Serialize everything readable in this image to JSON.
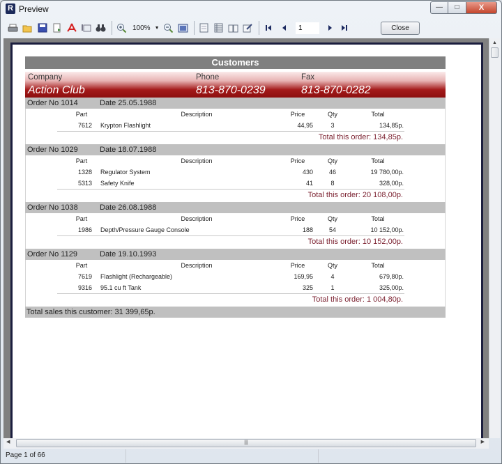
{
  "window": {
    "title": "Preview",
    "app_icon": "R",
    "buttons": {
      "minimize": "—",
      "maximize": "□",
      "close": "X"
    }
  },
  "toolbar": {
    "icons": [
      {
        "name": "print-icon",
        "glyph": "🖨"
      },
      {
        "name": "open-icon",
        "glyph": "📂"
      },
      {
        "name": "save-icon",
        "glyph": "💾"
      },
      {
        "name": "export-icon",
        "glyph": "📄"
      },
      {
        "name": "pdf-icon",
        "glyph": "ᴧ"
      },
      {
        "name": "email-icon",
        "glyph": "✉"
      },
      {
        "name": "find-icon",
        "glyph": "⚲"
      }
    ],
    "zoom_value": "100%",
    "page_number": "1",
    "close_label": "Close"
  },
  "report": {
    "title": "Customers",
    "customer": {
      "company_label": "Company",
      "phone_label": "Phone",
      "fax_label": "Fax",
      "company": "Action Club",
      "phone": "813-870-0239",
      "fax": "813-870-0282"
    },
    "columns": {
      "part": "Part",
      "description": "Description",
      "price": "Price",
      "qty": "Qty",
      "total": "Total"
    },
    "orders": [
      {
        "order_no": "Order No 1014",
        "date": "Date 25.05.1988",
        "items": [
          {
            "part": "7612",
            "description": "Krypton Flashlight",
            "price": "44,95",
            "qty": "3",
            "total": "134,85p."
          }
        ],
        "order_total": "Total this order: 134,85p."
      },
      {
        "order_no": "Order No 1029",
        "date": "Date 18.07.1988",
        "items": [
          {
            "part": "1328",
            "description": "Regulator System",
            "price": "430",
            "qty": "46",
            "total": "19 780,00p."
          },
          {
            "part": "5313",
            "description": "Safety Knife",
            "price": "41",
            "qty": "8",
            "total": "328,00p."
          }
        ],
        "order_total": "Total this order: 20 108,00p."
      },
      {
        "order_no": "Order No 1038",
        "date": "Date 26.08.1988",
        "items": [
          {
            "part": "1986",
            "description": "Depth/Pressure Gauge Console",
            "price": "188",
            "qty": "54",
            "total": "10 152,00p."
          }
        ],
        "order_total": "Total this order: 10 152,00p."
      },
      {
        "order_no": "Order No 1129",
        "date": "Date 19.10.1993",
        "items": [
          {
            "part": "7619",
            "description": "Flashlight (Rechargeable)",
            "price": "169,95",
            "qty": "4",
            "total": "679,80p."
          },
          {
            "part": "9316",
            "description": "95.1 cu ft Tank",
            "price": "325",
            "qty": "1",
            "total": "325,00p."
          }
        ],
        "order_total": "Total this order: 1 004,80p."
      }
    ],
    "grand_total": "Total sales this customer: 31 399,65p."
  },
  "status": {
    "page_info": "Page 1 of 66"
  }
}
